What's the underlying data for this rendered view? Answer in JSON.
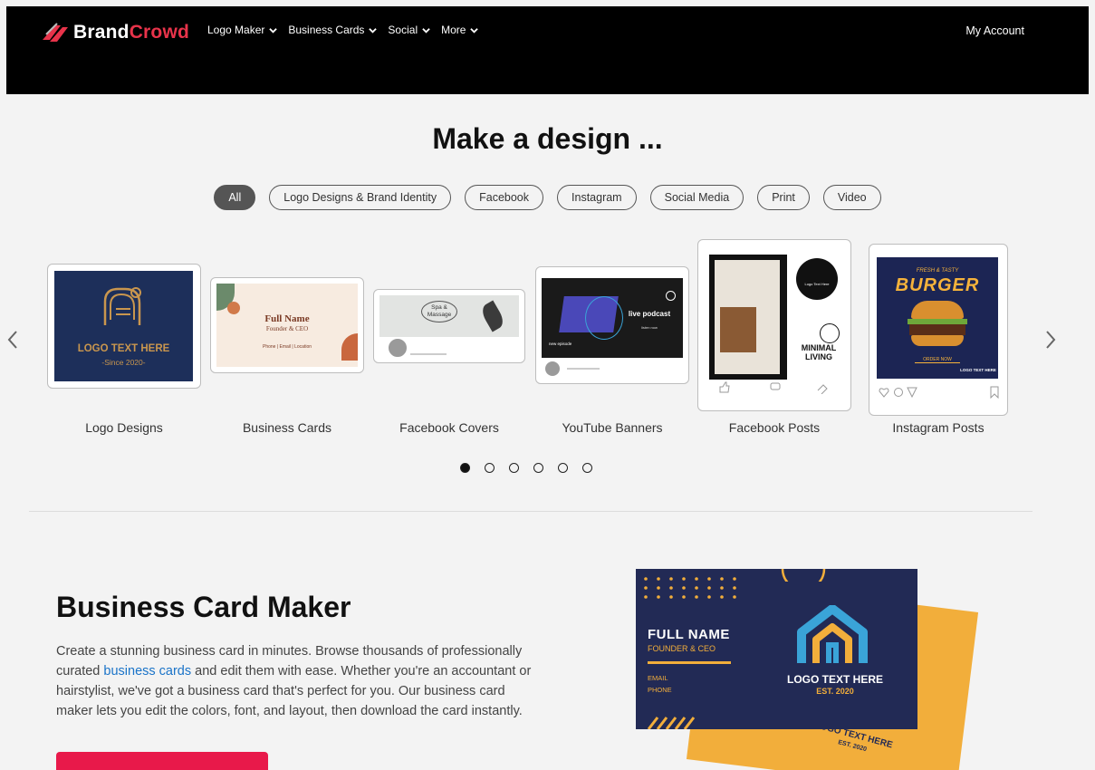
{
  "brand": {
    "name_part1": "Brand",
    "name_part2": "Crowd",
    "accent": "#e8334a"
  },
  "nav": {
    "items": [
      {
        "label": "Logo Maker"
      },
      {
        "label": "Business Cards"
      },
      {
        "label": "Social"
      },
      {
        "label": "More"
      }
    ],
    "account": "My Account"
  },
  "hero": {
    "title": "Make a design ..."
  },
  "filters": [
    "All",
    "Logo Designs & Brand Identity",
    "Facebook",
    "Instagram",
    "Social Media",
    "Print",
    "Video"
  ],
  "carousel": {
    "items": [
      {
        "label": "Logo Designs",
        "thumb_text": "LOGO TEXT HERE",
        "thumb_sub": "-Since 2020-"
      },
      {
        "label": "Business Cards",
        "thumb_text": "Full Name",
        "thumb_sub": "Founder & CEO",
        "thumb_small": "Phone | Email | Location"
      },
      {
        "label": "Facebook Covers",
        "thumb_text": "Spa & Massage"
      },
      {
        "label": "YouTube Banners",
        "thumb_text": "live podcast",
        "thumb_sub": "listen now",
        "thumb_small": "new episode"
      },
      {
        "label": "Facebook Posts",
        "thumb_text": "MINIMAL LIVING",
        "thumb_sub": "Logo Text Here"
      },
      {
        "label": "Instagram Posts",
        "thumb_text": "BURGER",
        "thumb_sub": "FRESH & TASTY",
        "thumb_small": "ORDER NOW",
        "thumb_logo": "LOGO TEXT HERE"
      }
    ],
    "dots_count": 6,
    "active_dot": 0
  },
  "section": {
    "title": "Business Card Maker",
    "body_before": "Create a stunning business card in minutes. Browse thousands of professionally curated ",
    "link": "business cards",
    "body_after": " and edit them with ease. Whether you're an accountant or hairstylist, we've got a business card that's perfect for you. Our business card maker lets you edit the colors, font, and layout, then download the card instantly.",
    "card_front": {
      "name": "FULL NAME",
      "role": "FOUNDER & CEO",
      "email": "EMAIL",
      "phone": "PHONE",
      "logo": "LOGO TEXT HERE",
      "est": "EST. 2020"
    },
    "card_back": {
      "logo": "LOGO TEXT HERE",
      "est": "EST. 2020"
    }
  }
}
